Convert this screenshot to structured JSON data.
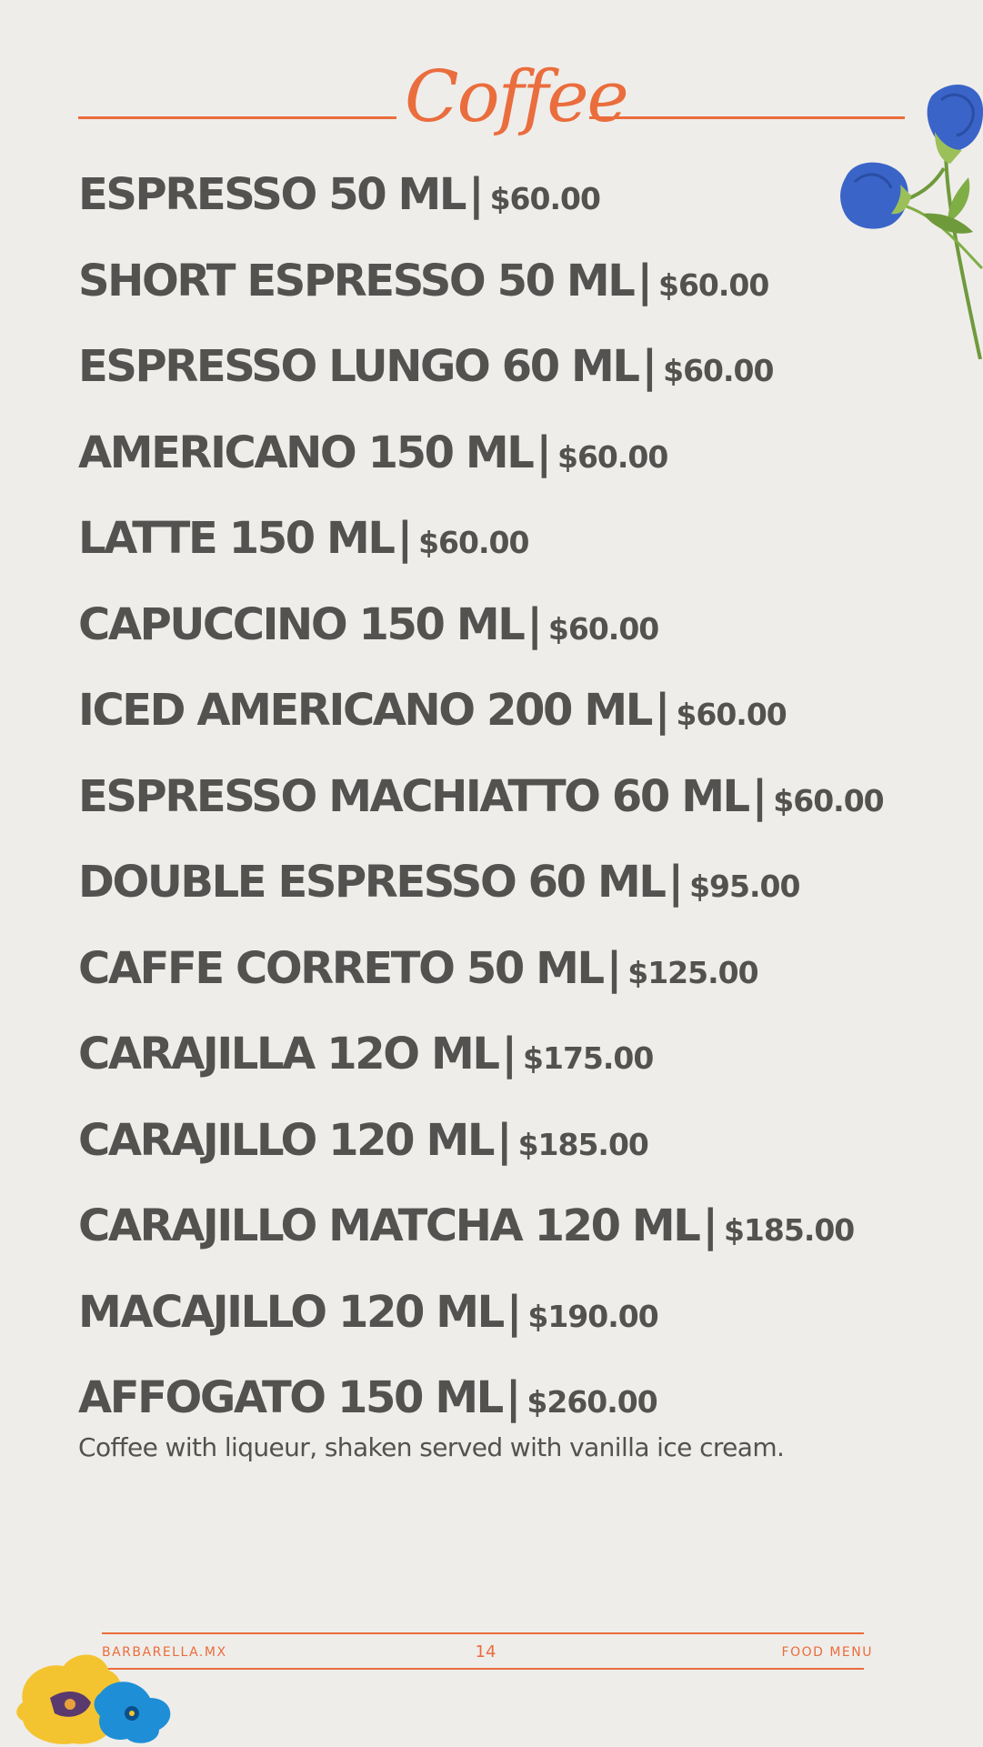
{
  "page": {
    "title": "Coffee",
    "accent_color": "#ea6d3d",
    "text_color": "#545250",
    "background_color": "#efedea"
  },
  "menu": {
    "separator": "|",
    "items": [
      {
        "name": "ESPRESSO 50 ML",
        "price": "$60.00"
      },
      {
        "name": "SHORT ESPRESSO 50 ML",
        "price": "$60.00"
      },
      {
        "name": "ESPRESSO LUNGO 60 ML",
        "price": "$60.00"
      },
      {
        "name": "AMERICANO 150 ML",
        "price": "$60.00"
      },
      {
        "name": "LATTE 150 ML",
        "price": "$60.00"
      },
      {
        "name": "CAPUCCINO 150 ML",
        "price": "$60.00"
      },
      {
        "name": "ICED AMERICANO 200 ML",
        "price": "$60.00"
      },
      {
        "name": "ESPRESSO MACHIATTO 60 ML",
        "price": "$60.00"
      },
      {
        "name": "DOUBLE ESPRESSO 60 ML",
        "price": "$95.00"
      },
      {
        "name": "CAFFE CORRETO 50 ML",
        "price": "$125.00"
      },
      {
        "name": "CARAJILLA 12O ML",
        "price": "$175.00"
      },
      {
        "name": "CARAJILLO 120 ML",
        "price": "$185.00"
      },
      {
        "name": "CARAJILLO MATCHA 120 ML",
        "price": "$185.00"
      },
      {
        "name": "MACAJILLO 120 ML",
        "price": "$190.00"
      },
      {
        "name": "AFFOGATO 150 ML",
        "price": "$260.00"
      }
    ],
    "last_item_description": "Coffee with liqueur, shaken served with vanilla ice cream."
  },
  "footer": {
    "website": "BARBARELLA.MX",
    "page_number": "14",
    "section": "FOOD MENU"
  },
  "decorations": {
    "top_right": "blue-flower-illustration",
    "bottom_left": "yellow-and-blue-flower-illustration"
  }
}
